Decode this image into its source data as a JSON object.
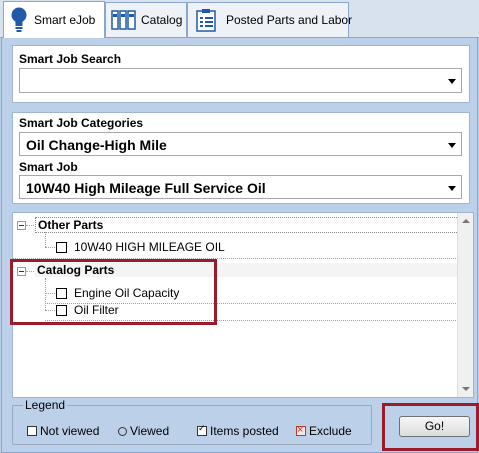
{
  "tabs": [
    {
      "label": "Smart eJob",
      "icon": "lightbulb-icon",
      "active": true
    },
    {
      "label": "Catalog",
      "icon": "catalog-books-icon",
      "active": false
    },
    {
      "label": "Posted Parts and Labor",
      "icon": "posted-list-icon",
      "active": false
    }
  ],
  "search": {
    "label": "Smart Job Search",
    "value": ""
  },
  "categories": {
    "label": "Smart Job Categories",
    "value": "Oil Change-High Mile"
  },
  "smartjob": {
    "label": "Smart Job",
    "value": "10W40 High Mileage Full Service Oil"
  },
  "tree": {
    "groups": [
      {
        "label": "Other Parts",
        "items": [
          {
            "label": "10W40 HIGH MILEAGE OIL"
          }
        ]
      },
      {
        "label": "Catalog Parts",
        "items": [
          {
            "label": "Engine Oil Capacity"
          },
          {
            "label": "Oil Filter"
          }
        ]
      }
    ]
  },
  "legend": {
    "title": "Legend",
    "items": [
      {
        "label": "Not viewed",
        "icon": "empty-square-icon"
      },
      {
        "label": "Viewed",
        "icon": "circle-icon"
      },
      {
        "label": "Items posted",
        "icon": "checked-square-icon"
      },
      {
        "label": "Exclude",
        "icon": "x-square-icon"
      }
    ]
  },
  "go_button": {
    "label": "Go!"
  },
  "colors": {
    "background": "#bcd0e9",
    "highlight": "#9b1b2a",
    "accent_blue": "#1f5aa6"
  }
}
